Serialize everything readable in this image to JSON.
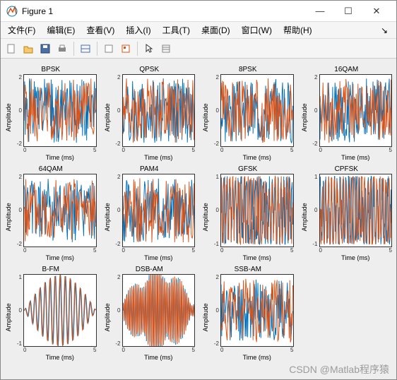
{
  "window": {
    "title": "Figure 1",
    "min": "—",
    "max": "☐",
    "close": "✕"
  },
  "menu": {
    "file": "文件(F)",
    "edit": "编辑(E)",
    "view": "查看(V)",
    "insert": "插入(I)",
    "tools": "工具(T)",
    "desktop": "桌面(D)",
    "window": "窗口(W)",
    "help": "帮助(H)",
    "accel": "↘"
  },
  "toolbar_icons": [
    "new",
    "open",
    "save",
    "print",
    "sep",
    "link",
    "sep",
    "rotate",
    "datacursor",
    "sep",
    "pointer",
    "pan"
  ],
  "chart_data": [
    {
      "type": "line",
      "title": "BPSK",
      "xlabel": "Time (ms)",
      "ylabel": "Amplitude",
      "xlim": [
        0,
        5
      ],
      "ylim": [
        -2,
        2
      ],
      "xticks": [
        0,
        5
      ],
      "yticks": [
        -2,
        0,
        2
      ],
      "style": "noise",
      "seed": 1
    },
    {
      "type": "line",
      "title": "QPSK",
      "xlabel": "Time (ms)",
      "ylabel": "Amplitude",
      "xlim": [
        0,
        5
      ],
      "ylim": [
        -2,
        2
      ],
      "xticks": [
        0,
        5
      ],
      "yticks": [
        -2,
        0,
        2
      ],
      "style": "noise",
      "seed": 2
    },
    {
      "type": "line",
      "title": "8PSK",
      "xlabel": "Time (ms)",
      "ylabel": "Amplitude",
      "xlim": [
        0,
        5
      ],
      "ylim": [
        -2,
        2
      ],
      "xticks": [
        0,
        5
      ],
      "yticks": [
        -2,
        0,
        2
      ],
      "style": "noise",
      "seed": 3
    },
    {
      "type": "line",
      "title": "16QAM",
      "xlabel": "Time (ms)",
      "ylabel": "Amplitude",
      "xlim": [
        0,
        5
      ],
      "ylim": [
        -2,
        2
      ],
      "xticks": [
        0,
        5
      ],
      "yticks": [
        -2,
        0,
        2
      ],
      "style": "noise",
      "seed": 4
    },
    {
      "type": "line",
      "title": "64QAM",
      "xlabel": "Time (ms)",
      "ylabel": "Amplitude",
      "xlim": [
        0,
        5
      ],
      "ylim": [
        -2,
        2
      ],
      "xticks": [
        0,
        5
      ],
      "yticks": [
        -2,
        0,
        2
      ],
      "style": "noise",
      "seed": 5
    },
    {
      "type": "line",
      "title": "PAM4",
      "xlabel": "Time (ms)",
      "ylabel": "Amplitude",
      "xlim": [
        0,
        5
      ],
      "ylim": [
        -2,
        2
      ],
      "xticks": [
        0,
        5
      ],
      "yticks": [
        -2,
        0,
        2
      ],
      "style": "noise",
      "seed": 6
    },
    {
      "type": "line",
      "title": "GFSK",
      "xlabel": "Time (ms)",
      "ylabel": "Amplitude",
      "xlim": [
        0,
        5
      ],
      "ylim": [
        -1,
        1
      ],
      "xticks": [
        0,
        5
      ],
      "yticks": [
        -1,
        0,
        1
      ],
      "style": "dense",
      "seed": 7
    },
    {
      "type": "line",
      "title": "CPFSK",
      "xlabel": "Time (ms)",
      "ylabel": "Amplitude",
      "xlim": [
        0,
        5
      ],
      "ylim": [
        -1,
        1
      ],
      "xticks": [
        0,
        5
      ],
      "yticks": [
        -1,
        0,
        1
      ],
      "style": "dense",
      "seed": 8
    },
    {
      "type": "line",
      "title": "B-FM",
      "xlabel": "Time (ms)",
      "ylabel": "Amplitude",
      "xlim": [
        0,
        5
      ],
      "ylim": [
        -1,
        1
      ],
      "xticks": [
        0,
        5
      ],
      "yticks": [
        -1,
        0,
        1
      ],
      "style": "fm",
      "seed": 9
    },
    {
      "type": "line",
      "title": "DSB-AM",
      "xlabel": "Time (ms)",
      "ylabel": "Amplitude",
      "xlim": [
        0,
        5
      ],
      "ylim": [
        -2,
        2
      ],
      "xticks": [
        0,
        5
      ],
      "yticks": [
        -2,
        0,
        2
      ],
      "style": "dsb",
      "seed": 10
    },
    {
      "type": "line",
      "title": "SSB-AM",
      "xlabel": "Time (ms)",
      "ylabel": "Amplitude",
      "xlim": [
        0,
        5
      ],
      "ylim": [
        -2,
        2
      ],
      "xticks": [
        0,
        5
      ],
      "yticks": [
        -2,
        0,
        2
      ],
      "style": "noise",
      "seed": 11
    }
  ],
  "watermark": "CSDN @Matlab程序猿"
}
